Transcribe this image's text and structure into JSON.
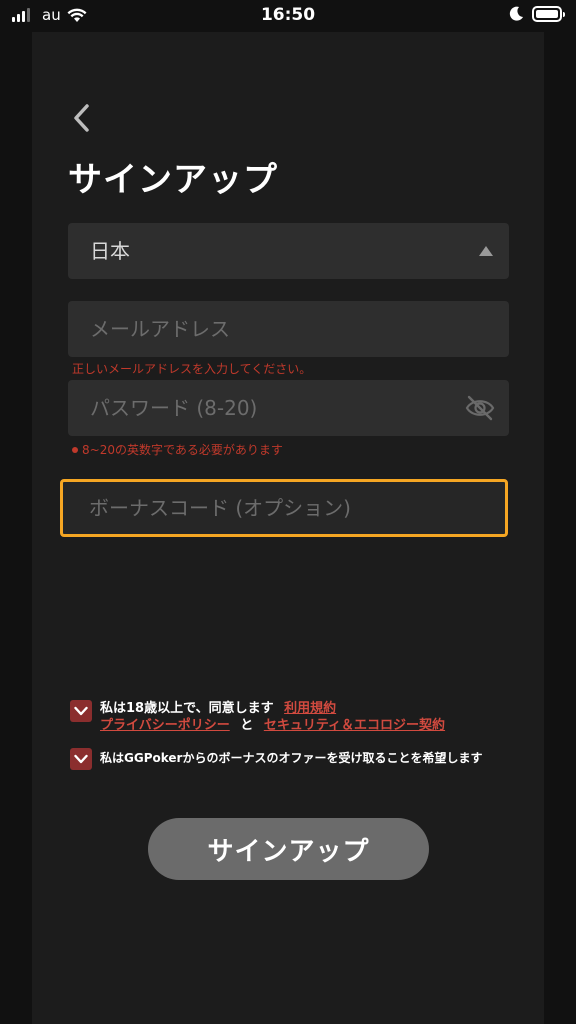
{
  "status_bar": {
    "carrier": "au",
    "time": "16:50",
    "icons": [
      "signal-icon",
      "wifi-icon",
      "moon-icon",
      "battery-icon"
    ]
  },
  "header": {
    "back_icon": "chevron-left-icon",
    "title": "サインアップ"
  },
  "form": {
    "country": {
      "value": "日本",
      "icon": "caret-up-icon"
    },
    "email": {
      "placeholder": "メールアドレス",
      "error": "正しいメールアドレスを入力してください。"
    },
    "password": {
      "placeholder": "パスワード (8-20)",
      "hint": "8~20の英数字である必要があります",
      "icon": "eye-off-icon"
    },
    "bonus_code": {
      "placeholder": "ボーナスコード (オプション)"
    }
  },
  "agreements": {
    "terms": {
      "text": "私は18歳以上で、同意します",
      "link_terms": "利用規約",
      "link_privacy": "プライバシーポリシー",
      "conjunction": "と",
      "link_security": "セキュリティ＆エコロジー契約"
    },
    "bonus_offer": {
      "text": "私はGGPokerからのボーナスのオファーを受け取ることを希望します"
    }
  },
  "submit": {
    "label": "サインアップ"
  },
  "colors": {
    "accent_focus": "#f5a623",
    "error": "#c0392b",
    "link": "#d14a3f",
    "checkbox": "#8b2e2e",
    "button": "#6b6b6b"
  }
}
